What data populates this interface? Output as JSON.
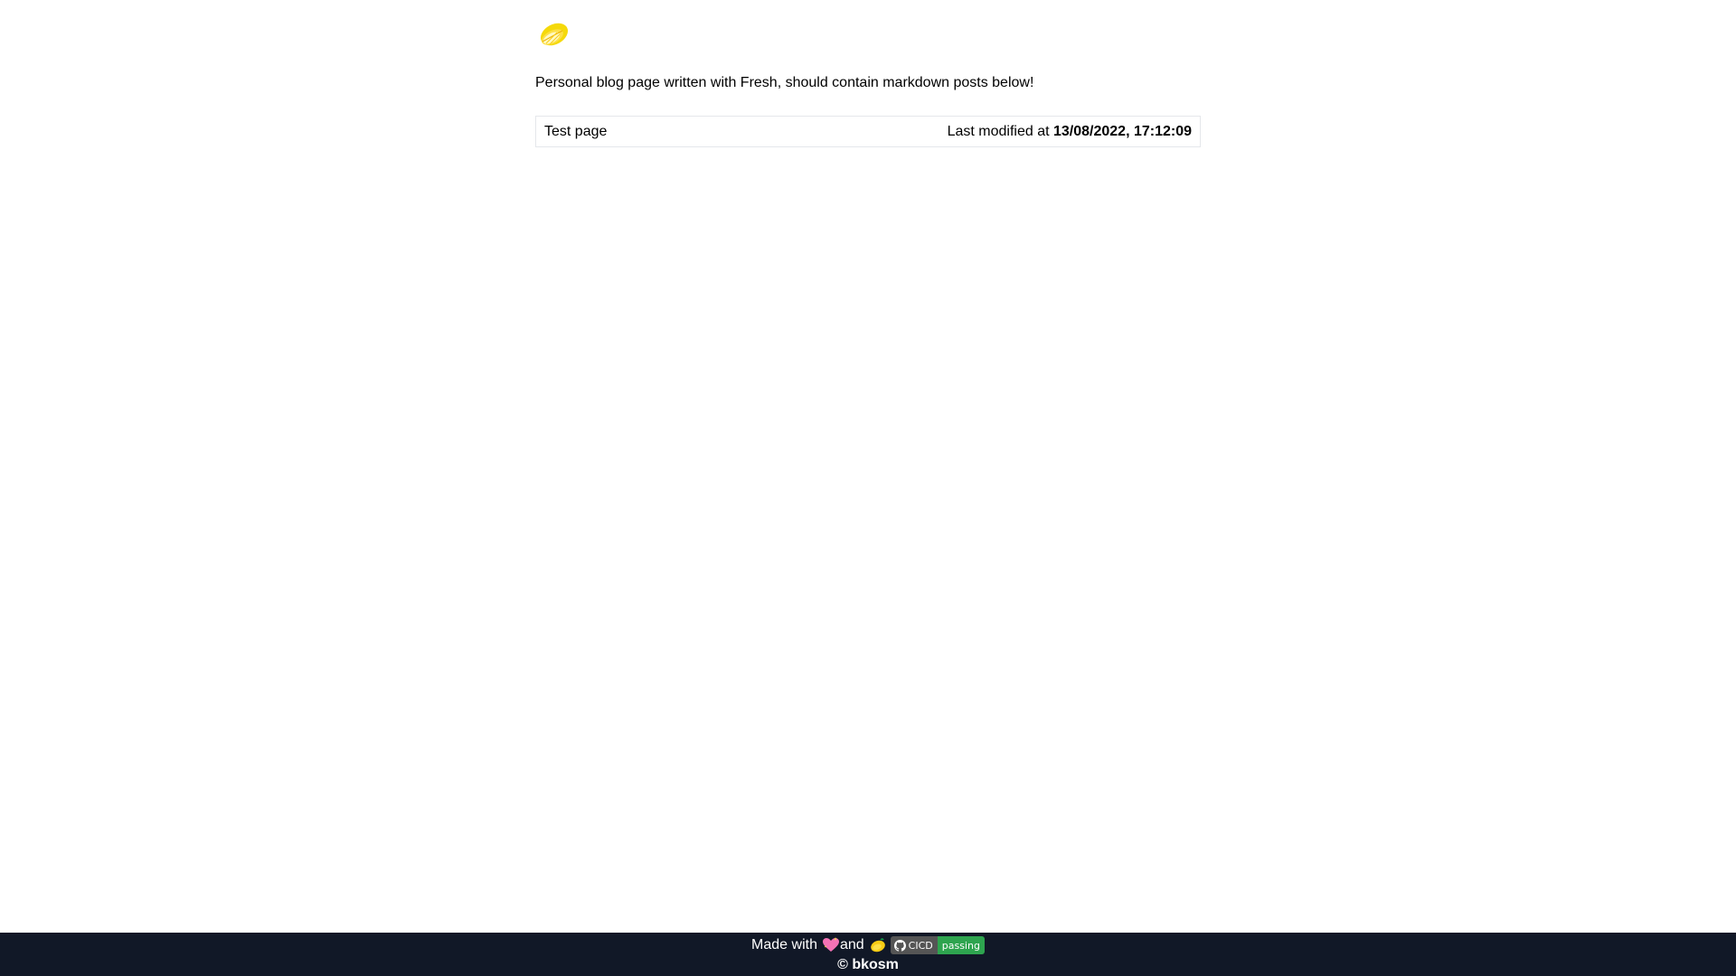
{
  "header": {
    "logo_icon": "lemon-icon"
  },
  "intro": {
    "text": "Personal blog page written with Fresh, should contain markdown posts below!"
  },
  "posts": [
    {
      "title": "Test page",
      "modified_prefix": "Last modified at",
      "modified_date": "13/08/2022, 17:12:09"
    }
  ],
  "footer": {
    "made_with": "Made with",
    "heart_icon": "sparkling-heart-icon",
    "and": "and",
    "lemon_icon": "lemon-icon",
    "badge": {
      "icon": "github-icon",
      "label": "CICD",
      "status": "passing",
      "status_color": "#2ea44f"
    },
    "copyright": "© bkosm"
  },
  "colors": {
    "footer_bg": "#111827",
    "border": "#e5e7eb",
    "lemon": "#f5d90a"
  }
}
